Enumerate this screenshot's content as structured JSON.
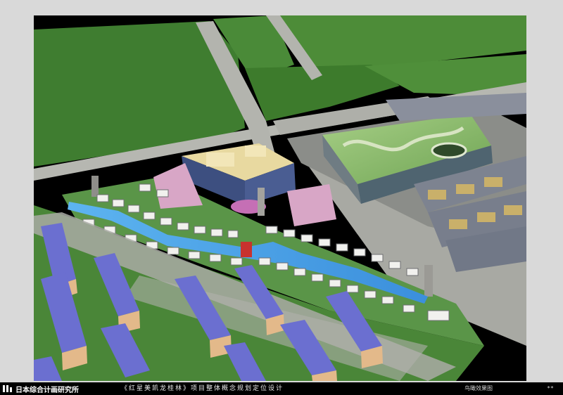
{
  "header": {
    "logo_text": "日本综合计画研究所"
  },
  "footer": {
    "caption": "《红星美凯龙桂林》项目整体概念规划定位设计",
    "right_label": "鸟瞰效果图",
    "page_number": "**"
  },
  "colors": {
    "page_background": "#d9d9d9",
    "frame_background": "#000000",
    "grass": "#4e8a3a",
    "road": "#a9aaa6",
    "canal": "#4fa3e6",
    "roof_purple": "#6b6fd0",
    "facade_tan": "#e3b98a",
    "mall_roof": "#8fbe6e"
  },
  "icons": {
    "logo_mark": "stylized-logo-icon"
  }
}
